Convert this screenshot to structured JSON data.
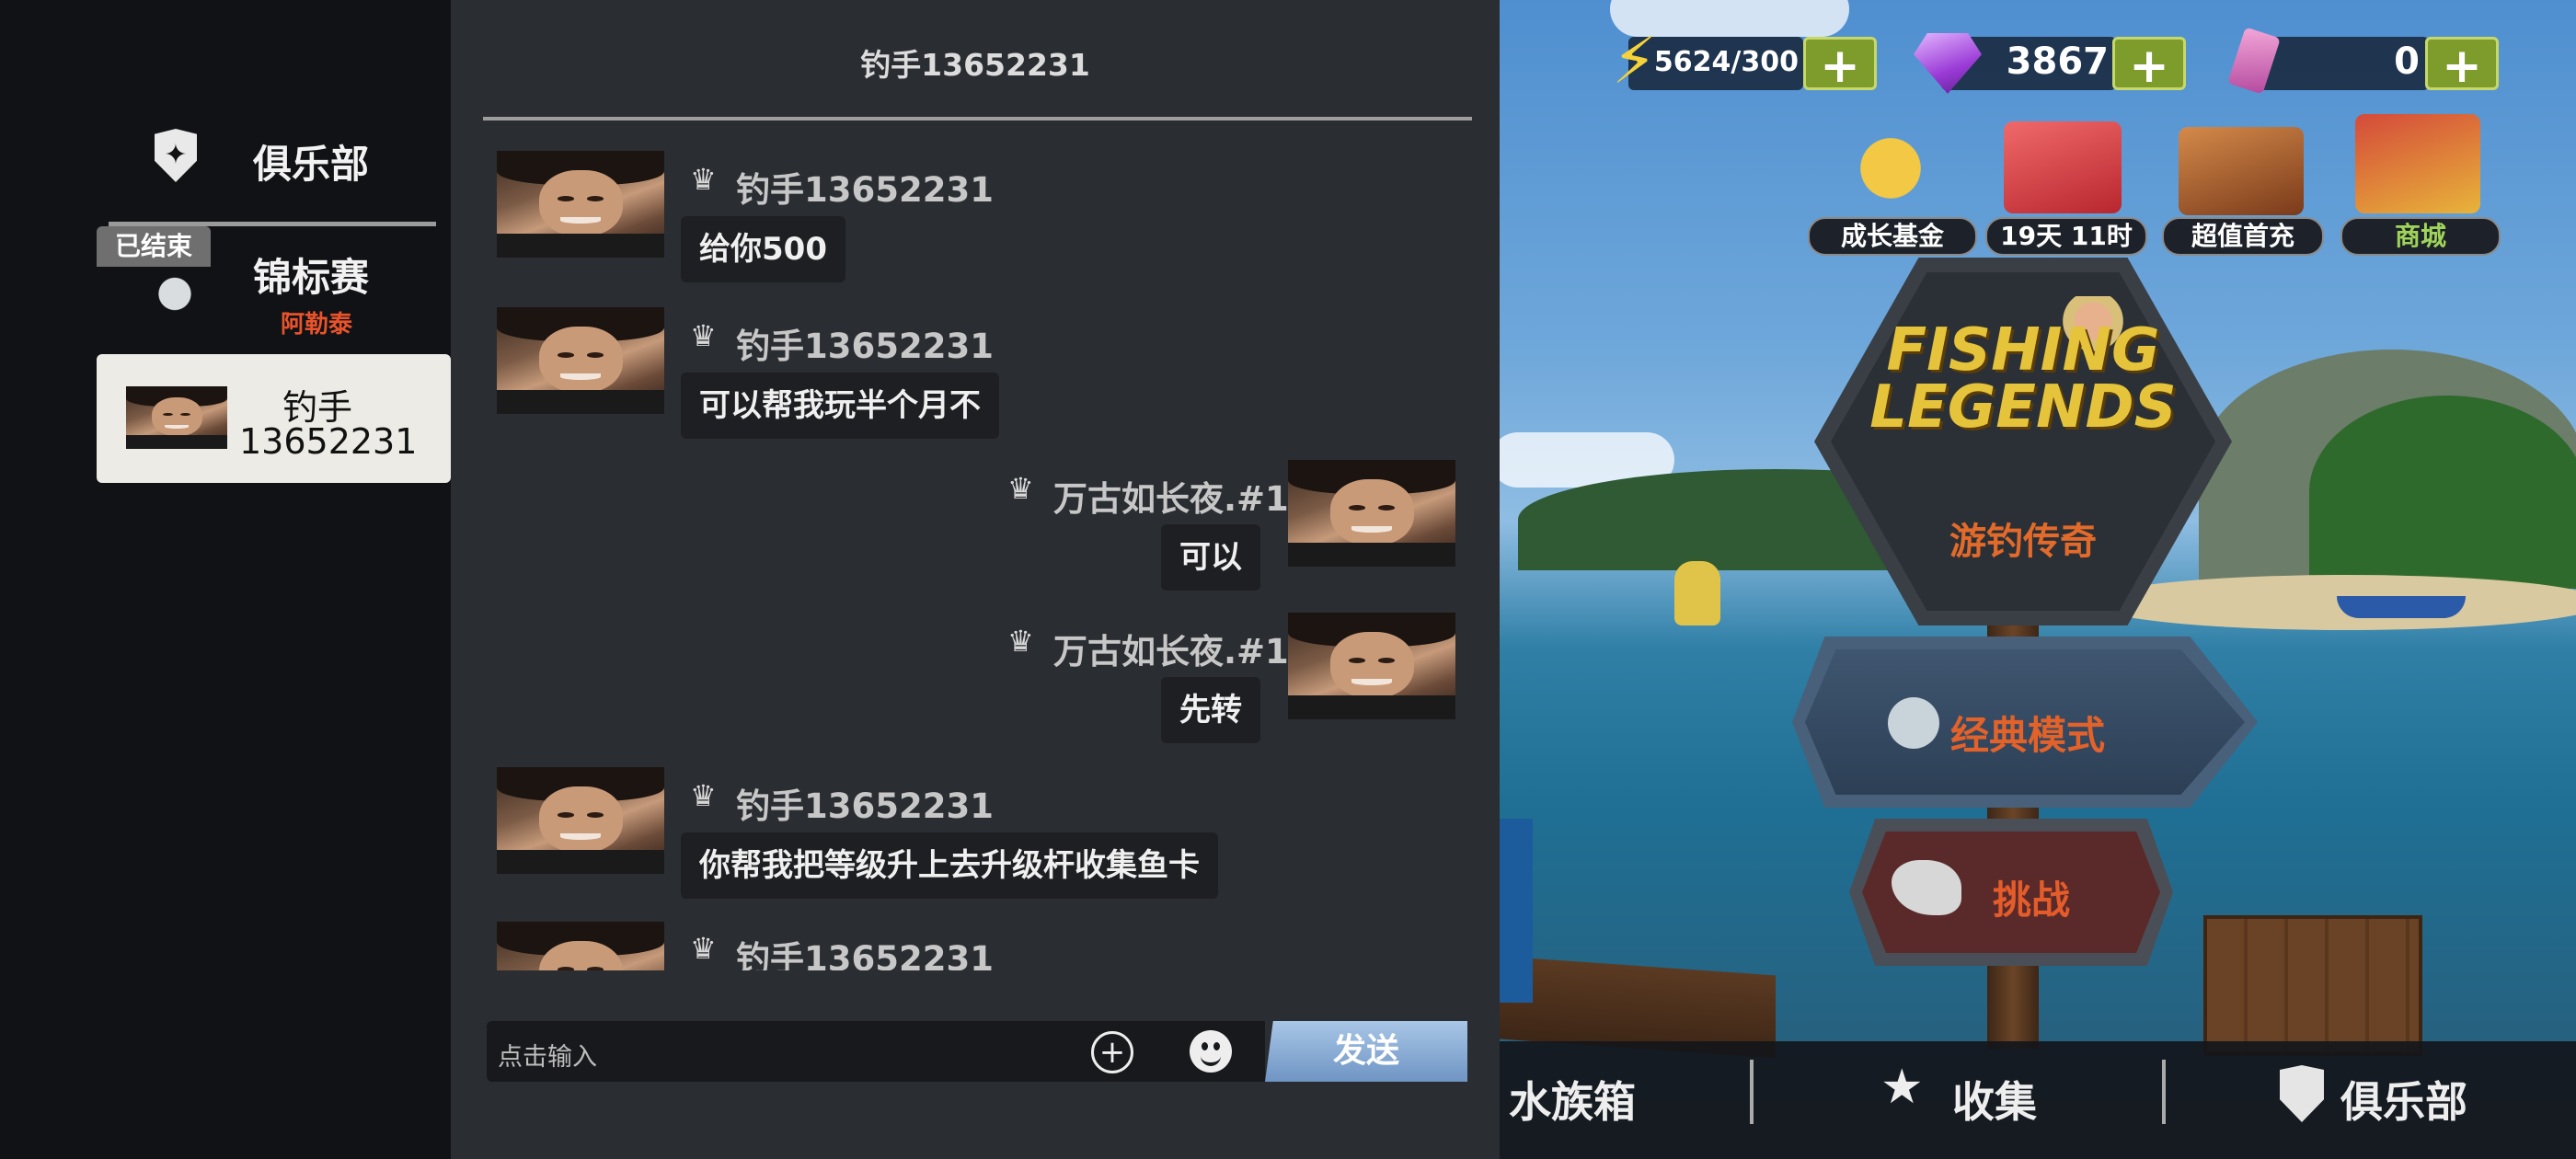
{
  "sidebar": {
    "items": [
      {
        "label": "俱乐部",
        "icon": "club-shield-icon"
      },
      {
        "label": "锦标赛",
        "sublabel": "阿勒泰",
        "badge": "已结束",
        "icon": "globe-boat-icon"
      },
      {
        "label_line1": "钓手",
        "label_line2": "13652231",
        "icon": "avatar"
      }
    ]
  },
  "chat": {
    "title": "钓手13652231",
    "messages": [
      {
        "side": "left",
        "sender": "钓手13652231",
        "text": "给你500"
      },
      {
        "side": "left",
        "sender": "钓手13652231",
        "text": "可以帮我玩半个月不"
      },
      {
        "side": "right",
        "sender": "万古如长夜.#1",
        "text": "可以"
      },
      {
        "side": "right",
        "sender": "万古如长夜.#1",
        "text": "先转"
      },
      {
        "side": "left",
        "sender": "钓手13652231",
        "text": "你帮我把等级升上去升级杆收集鱼卡"
      },
      {
        "side": "left",
        "sender": "钓手13652231",
        "text": ""
      }
    ],
    "input_placeholder": "点击输入",
    "send_label": "发送",
    "crown_glyph": "♛"
  },
  "hud": {
    "energy": "5624/300",
    "gems": "3867",
    "tickets": "0",
    "plus": "+",
    "shortcuts": [
      {
        "label": "成长基金",
        "icon": "growth-fund-icon"
      },
      {
        "label": "19天 11时",
        "icon": "gift-box-icon"
      },
      {
        "label": "超值首充",
        "icon": "first-recharge-icon"
      },
      {
        "label": "商城",
        "icon": "shop-cart-icon"
      }
    ]
  },
  "signpost": {
    "logo_line1": "FISHING",
    "logo_line2": "LEGENDS",
    "subtitle": "游钓传奇",
    "classic_mode": "经典模式",
    "challenge": "挑战"
  },
  "bottom_nav": {
    "aquarium": "水族箱",
    "collect": "收集",
    "club": "俱乐部"
  },
  "colors": {
    "accent_orange": "#e26a2a",
    "send_blue": "#8fb3dc",
    "plus_green": "#7e9c2c",
    "chat_bg": "#2a2d31"
  }
}
